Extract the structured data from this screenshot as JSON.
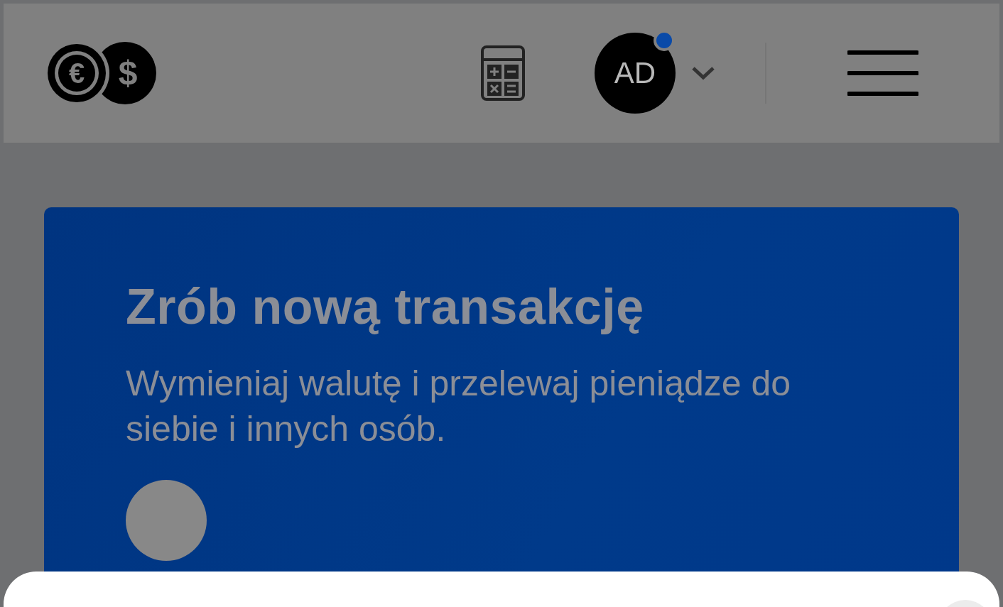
{
  "header": {
    "logo": [
      "€",
      "$"
    ],
    "avatar": {
      "initials": "AD",
      "notification": true
    }
  },
  "card": {
    "title": "Zrób nową transakcję",
    "text": "Wymieniaj walutę i przelewaj pieniądze do siebie i innych osób."
  }
}
